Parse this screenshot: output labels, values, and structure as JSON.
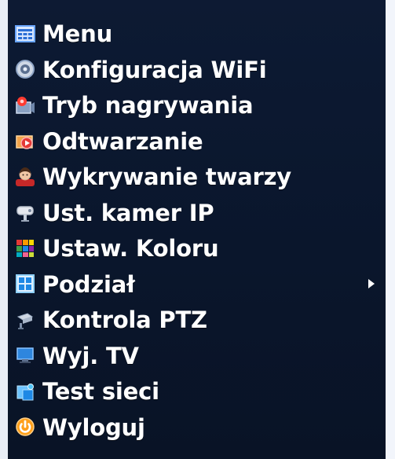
{
  "menu": {
    "items": [
      {
        "label": "Menu",
        "icon": "menu-icon"
      },
      {
        "label": "Konfiguracja WiFi",
        "icon": "wifi-config-icon"
      },
      {
        "label": "Tryb nagrywania",
        "icon": "record-mode-icon"
      },
      {
        "label": "Odtwarzanie",
        "icon": "playback-icon"
      },
      {
        "label": "Wykrywanie twarzy",
        "icon": "face-detection-icon"
      },
      {
        "label": "Ust. kamer IP",
        "icon": "ip-camera-icon"
      },
      {
        "label": "Ustaw. Koloru",
        "icon": "color-settings-icon"
      },
      {
        "label": "Podział",
        "icon": "split-screen-icon",
        "has_submenu": true
      },
      {
        "label": "Kontrola PTZ",
        "icon": "ptz-control-icon"
      },
      {
        "label": "Wyj. TV",
        "icon": "tv-output-icon"
      },
      {
        "label": "Test sieci",
        "icon": "network-test-icon"
      },
      {
        "label": "Wyloguj",
        "icon": "logout-icon"
      }
    ]
  },
  "colors": {
    "panel_background": "#0b1730",
    "text": "#ffffff",
    "accent_orange": "#ff9f1a",
    "accent_red": "#e53935",
    "accent_blue": "#4da3ff",
    "accent_green": "#4caf50"
  }
}
